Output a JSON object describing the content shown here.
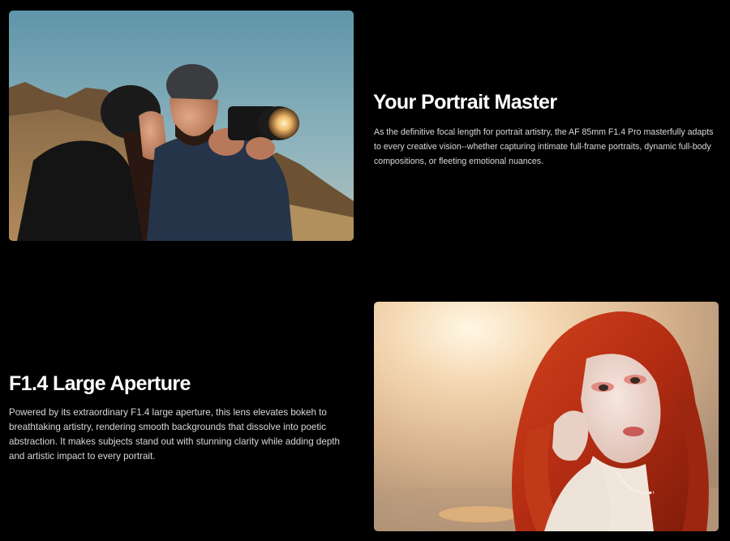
{
  "sections": [
    {
      "title": "Your Portrait Master",
      "description": "As the definitive focal length for portrait artistry, the AF 85mm F1.4 Pro masterfully adapts to every creative vision--whether capturing intimate full-frame portraits, dynamic full-body compositions, or fleeting emotional nuances."
    },
    {
      "title": "F1.4 Large Aperture",
      "description": "Powered by its extraordinary F1.4 large aperture, this lens elevates bokeh to breathtaking artistry, rendering smooth backgrounds that dissolve into poetic abstraction. It makes subjects stand out with stunning clarity while adding depth and artistic impact to every portrait."
    }
  ],
  "colors": {
    "background": "#000000",
    "title": "#ffffff",
    "body_text": "#d9d9d9"
  }
}
